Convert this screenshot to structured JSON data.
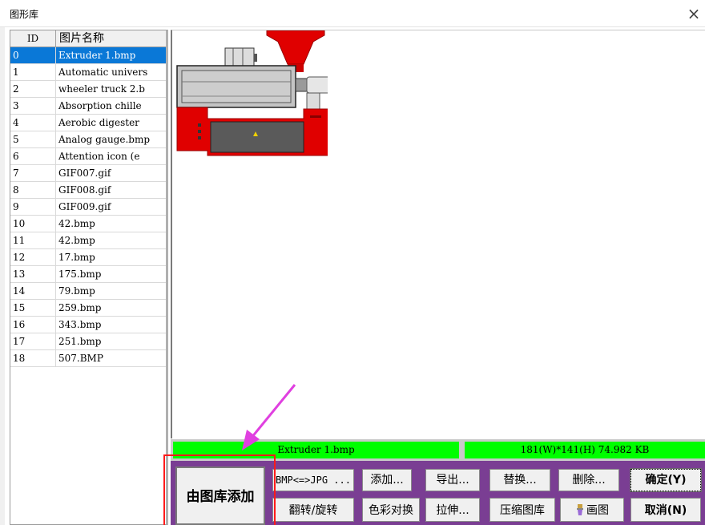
{
  "window": {
    "title": "图形库",
    "close_glyph": "×"
  },
  "list": {
    "columns": {
      "id": "ID",
      "name": "图片名称"
    },
    "rows": [
      {
        "id": "0",
        "name": "Extruder 1.bmp"
      },
      {
        "id": "1",
        "name": "Automatic univers"
      },
      {
        "id": "2",
        "name": "wheeler truck 2.b"
      },
      {
        "id": "3",
        "name": "Absorption chille"
      },
      {
        "id": "4",
        "name": "Aerobic digester"
      },
      {
        "id": "5",
        "name": "Analog gauge.bmp"
      },
      {
        "id": "6",
        "name": "Attention icon (e"
      },
      {
        "id": "7",
        "name": "GIF007.gif"
      },
      {
        "id": "8",
        "name": "GIF008.gif"
      },
      {
        "id": "9",
        "name": "GIF009.gif"
      },
      {
        "id": "10",
        "name": "42.bmp"
      },
      {
        "id": "11",
        "name": "42.bmp"
      },
      {
        "id": "12",
        "name": "17.bmp"
      },
      {
        "id": "13",
        "name": "175.bmp"
      },
      {
        "id": "14",
        "name": "79.bmp"
      },
      {
        "id": "15",
        "name": "259.bmp"
      },
      {
        "id": "16",
        "name": "343.bmp"
      },
      {
        "id": "17",
        "name": "251.bmp"
      },
      {
        "id": "18",
        "name": "507.BMP"
      }
    ],
    "selected_index": 0
  },
  "preview": {
    "image_icon": "extruder-machine-image"
  },
  "status": {
    "file_name": "Extruder 1.bmp",
    "info": "181(W)*141(H)   74.982 KB"
  },
  "buttons": {
    "add_from_library": "由图库添加",
    "bmp_jpg": "BMP<=>JPG ...",
    "add": "添加...",
    "export": "导出...",
    "replace": "替换...",
    "delete": "删除...",
    "ok": "确定(Y)",
    "flip_rotate": "翻转/旋转",
    "color_swap": "色彩对换",
    "stretch": "拉伸...",
    "compress": "压缩图库",
    "paint": "画图",
    "cancel": "取消(N)"
  },
  "colors": {
    "status_green": "#00ff00",
    "button_bar_purple": "#7a3e93",
    "selection_blue": "#0a78d7",
    "annotation_red": "#ff1a1a",
    "annotation_arrow_magenta": "#e040e0"
  }
}
